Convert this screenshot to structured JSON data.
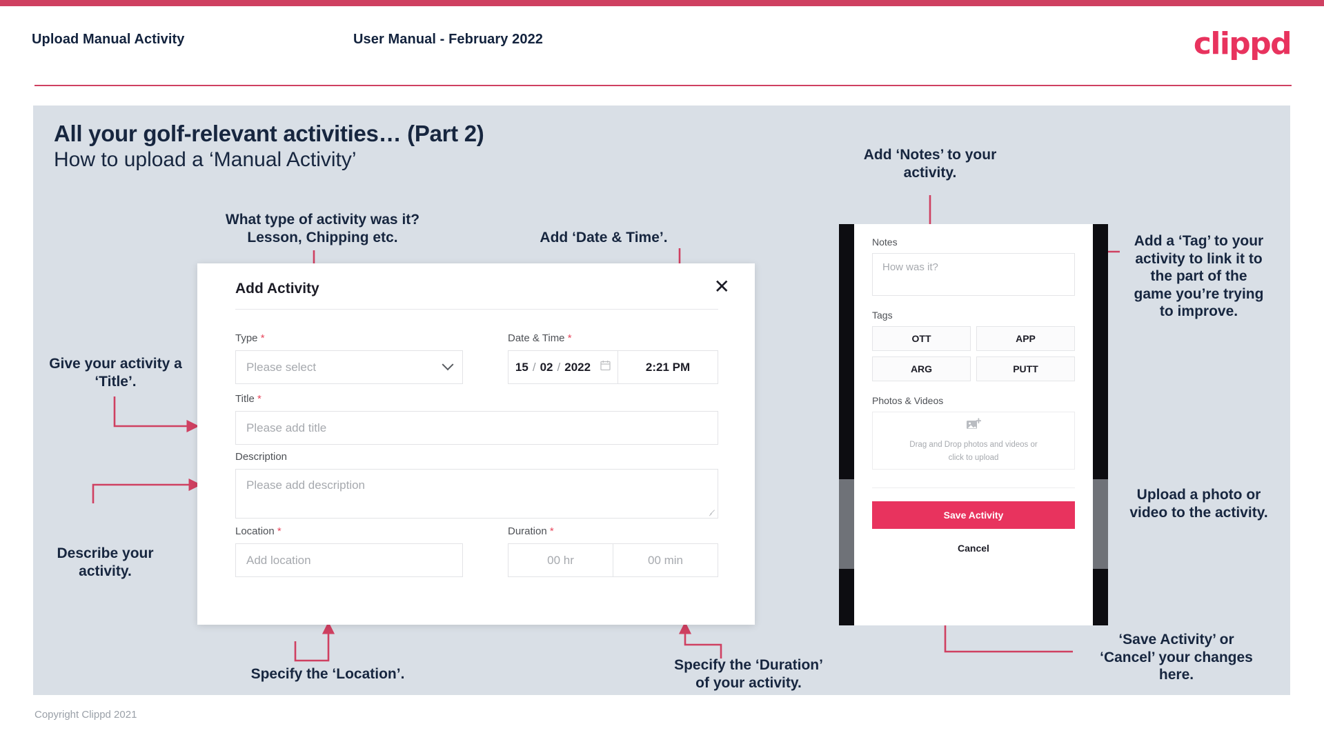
{
  "header": {
    "title": "Upload Manual Activity",
    "subtitle": "User Manual - February 2022",
    "logo": "clippd",
    "accent_color": "#cf4061"
  },
  "slide": {
    "heading": "All your golf-relevant activities… (Part 2)",
    "subheading": "How to upload a ‘Manual Activity’",
    "background_color": "#d9dfe6"
  },
  "footer": {
    "copyright": "Copyright Clippd 2021"
  },
  "annotations": {
    "type": "What type of activity was it?\nLesson, Chipping etc.",
    "date_time": "Add ‘Date & Time’.",
    "title": "Give your activity a\n‘Title’.",
    "description": "Describe your\nactivity.",
    "location": "Specify the ‘Location’.",
    "duration": "Specify the ‘Duration’\nof your activity.",
    "notes": "Add ‘Notes’ to your\nactivity.",
    "tags": "Add a ‘Tag’ to your\nactivity to link it to\nthe part of the\ngame you’re trying\nto improve.",
    "upload": "Upload a photo or\nvideo to the activity.",
    "save_cancel": "‘Save Activity’ or\n‘Cancel’ your changes\nhere."
  },
  "modal": {
    "title": "Add Activity",
    "close_icon": "close-icon",
    "fields": {
      "type": {
        "label": "Type",
        "required": "*",
        "placeholder": "Please select"
      },
      "date_time": {
        "label": "Date & Time",
        "required": "*",
        "day": "15",
        "month": "02",
        "year": "2022",
        "sep1": "/",
        "sep2": "/",
        "time": "2:21 PM"
      },
      "title": {
        "label": "Title",
        "required": "*",
        "placeholder": "Please add title"
      },
      "description": {
        "label": "Description",
        "required": "",
        "placeholder": "Please add description"
      },
      "location": {
        "label": "Location",
        "required": "*",
        "placeholder": "Add location"
      },
      "duration": {
        "label": "Duration",
        "required": "*",
        "hours": "00 hr",
        "minutes": "00 min"
      }
    }
  },
  "phone": {
    "notes": {
      "label": "Notes",
      "placeholder": "How was it?"
    },
    "tags": {
      "label": "Tags",
      "items": [
        {
          "label": "OTT"
        },
        {
          "label": "APP"
        },
        {
          "label": "ARG"
        },
        {
          "label": "PUTT"
        }
      ]
    },
    "media": {
      "label": "Photos & Videos",
      "icon": "add-image-icon",
      "line1": "Drag and Drop photos and videos or",
      "line2": "click to upload"
    },
    "save_label": "Save Activity",
    "cancel_label": "Cancel",
    "save_color": "#e8335e"
  }
}
